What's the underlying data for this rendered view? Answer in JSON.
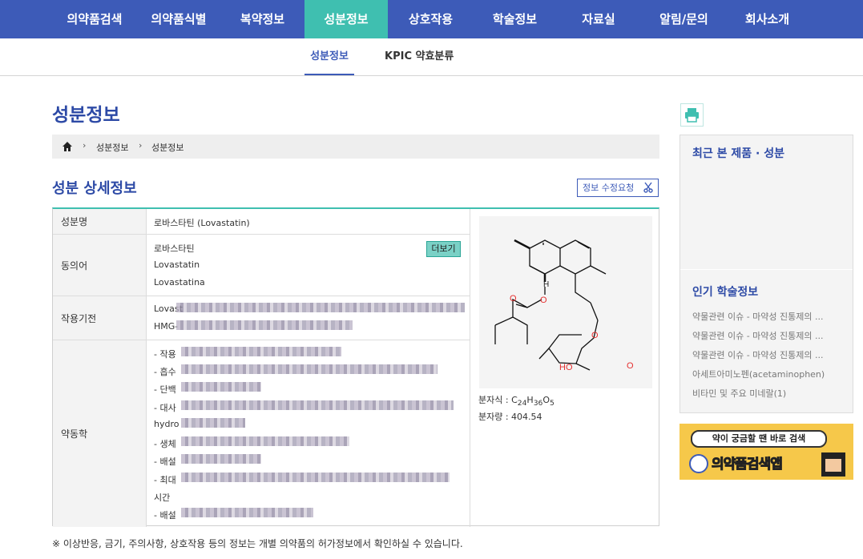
{
  "gnb": [
    "의약품검색",
    "의약품식별",
    "복약정보",
    "성분정보",
    "상호작용",
    "학술정보",
    "자료실",
    "알림/문의",
    "회사소개"
  ],
  "lnb": [
    "성분정보",
    "KPIC 약효분류"
  ],
  "page_title": "성분정보",
  "breadcrumb": [
    "성분정보",
    "성분정보"
  ],
  "section_title": "성분 상세정보",
  "edit_button": "정보 수정요청",
  "ingredient": {
    "name_label": "성분명",
    "name_value": "로바스타틴 (Lovastatin)",
    "synonym_label": "동의어",
    "synonyms": [
      "로바스타틴",
      "Lovastatin",
      "Lovastatina"
    ],
    "more_button": "더보기",
    "mechanism_label": "작용기전",
    "mechanism_lines": [
      "Lovast",
      "HMG-"
    ],
    "pk_label": "약동학",
    "pk_lines": [
      "- 작용",
      "- 흡수",
      "- 단백",
      "- 대사",
      "hydro",
      "- 생체",
      "- 배설",
      "- 최대",
      "시간",
      "- 배설"
    ],
    "formula_label": "분자식 : ",
    "formula_C": "C",
    "formula_c_n": "24",
    "formula_H": "H",
    "formula_h_n": "36",
    "formula_O": "O",
    "formula_o_n": "5",
    "mw": "분자량 : 404.54",
    "structure_H": "H",
    "structure_O": "O",
    "structure_HO": "HO"
  },
  "note": "※ 이상반응, 금기, 주의사항, 상호작용 등의 정보는 개별 의약품의 허가정보에서 확인하실 수 있습니다.",
  "aside": {
    "recent_title": "최근 본 제품 · 성분",
    "popular_title": "인기 학술정보",
    "popular_items": [
      "약물관련 이슈 - 마약성 진통제의 ...",
      "약물관련 이슈 - 마약성 진통제의 ...",
      "약물관련 이슈 - 마약성 진통제의 ...",
      "아세트아미노펜(acetaminophen)",
      "비타민 및 주요 미네랄(1)"
    ]
  },
  "banner": {
    "bubble": "약이 궁금할 땐 바로 검색",
    "app_name": "의약품검색앱"
  },
  "colors": {
    "nav_blue": "#3d5bb8",
    "accent_teal": "#3fbfb0",
    "title_blue": "#2d4aa6"
  }
}
